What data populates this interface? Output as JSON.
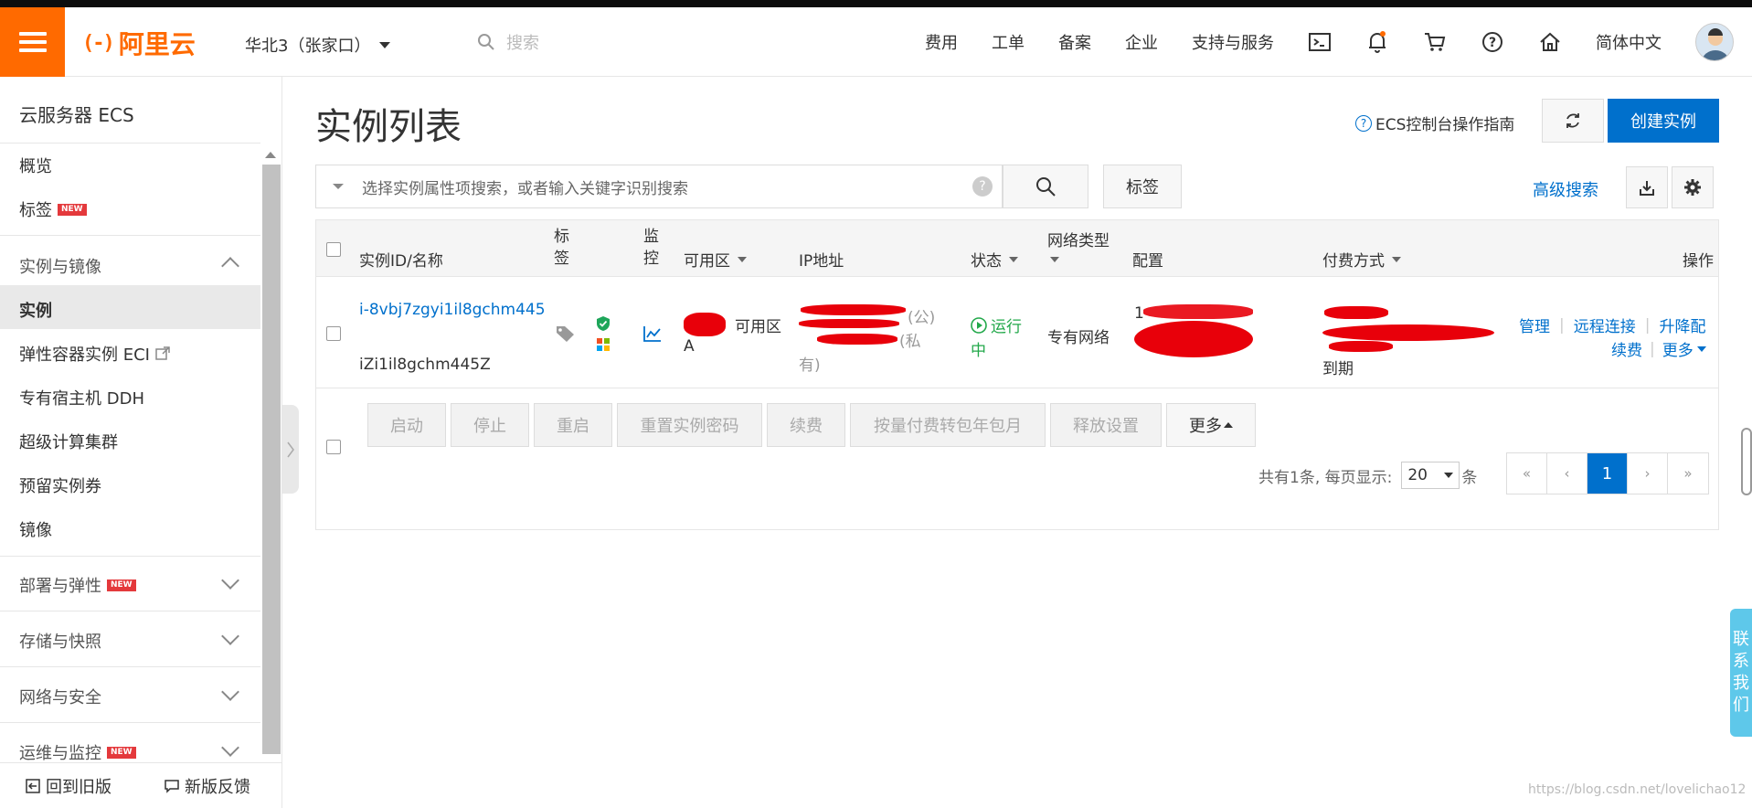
{
  "topnav": {
    "logo_mark": "(-)",
    "logo_text": "阿里云",
    "region": "华北3（张家口）",
    "search_placeholder": "搜索",
    "links": [
      "费用",
      "工单",
      "备案",
      "企业",
      "支持与服务"
    ],
    "language": "简体中文",
    "icons": [
      "terminal-icon",
      "bell-icon",
      "cart-icon",
      "help-icon",
      "home-icon"
    ]
  },
  "sidebar": {
    "title": "云服务器 ECS",
    "items": {
      "overview": "概览",
      "tags": "标签",
      "instances_images": "实例与镜像",
      "instances": "实例",
      "eci": "弹性容器实例 ECI",
      "ddh": "专有宿主机 DDH",
      "hpc": "超级计算集群",
      "reserved": "预留实例券",
      "images": "镜像",
      "deploy": "部署与弹性",
      "storage": "存储与快照",
      "network": "网络与安全",
      "ops": "运维与监控"
    },
    "new_badge": "NEW",
    "bottom": {
      "old_version": "回到旧版",
      "feedback": "新版反馈"
    }
  },
  "main": {
    "title": "实例列表",
    "guide": "ECS控制台操作指南",
    "create_btn": "创建实例",
    "filter_placeholder": "选择实例属性项搜索，或者输入关键字识别搜索",
    "tag_btn": "标签",
    "advanced_search": "高级搜索"
  },
  "table": {
    "headers": {
      "id_name": "实例ID/名称",
      "tag": "标签",
      "monitor": "监控",
      "zone": "可用区",
      "ip": "IP地址",
      "status": "状态",
      "network": "网络类型",
      "config": "配置",
      "billing": "付费方式",
      "actions": "操作"
    },
    "row": {
      "instance_id": "i-8vbj7zgyi1il8gchm445",
      "instance_name": "iZi1il8gchm445Z",
      "zone_suffix": "可用区",
      "zone_line2": "A",
      "ip_public": "(公)",
      "ip_private_a": "(私",
      "ip_private_b": "有)",
      "status_a": "运行",
      "status_b": "中",
      "network": "专有网络",
      "config_fragment": "1",
      "billing_expire": "到期",
      "actions": {
        "manage": "管理",
        "remote": "远程连接",
        "resize": "升降配",
        "renew": "续费",
        "more": "更多"
      }
    },
    "batch_buttons": [
      "启动",
      "停止",
      "重启",
      "重置实例密码",
      "续费",
      "按量付费转包年包月",
      "释放设置"
    ],
    "batch_more": "更多",
    "pager": {
      "summary": "共有1条, 每页显示:",
      "page_size": "20",
      "unit": "条",
      "first": "«",
      "prev": "‹",
      "current": "1",
      "next": "›",
      "last": "»"
    }
  },
  "floating": {
    "contact": [
      "联",
      "系",
      "我",
      "们"
    ],
    "watermark": "https://blog.csdn.net/lovelichao12"
  },
  "colors": {
    "brand_orange": "#ff6a00",
    "primary_blue": "#0070cc",
    "running_green": "#22a84a"
  }
}
